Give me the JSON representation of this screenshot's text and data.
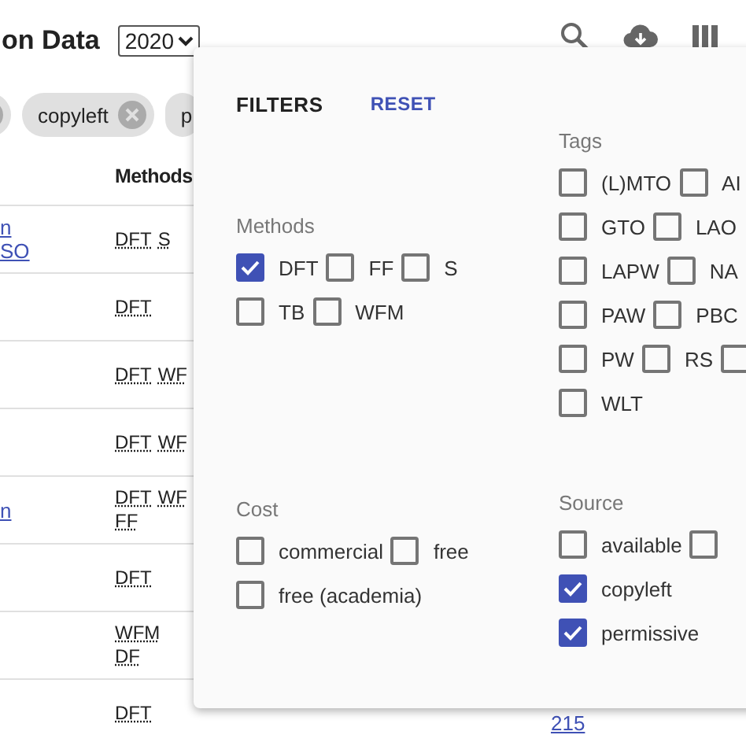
{
  "header": {
    "title": "on Data",
    "year": "2020"
  },
  "chips": [
    "copyleft",
    "p"
  ],
  "table": {
    "columns": [
      "Methods"
    ],
    "rows": [
      {
        "column_1": [
          "n",
          "SO"
        ],
        "methods": [
          "DFT",
          "S"
        ]
      },
      {
        "methods": [
          "DFT"
        ]
      },
      {
        "methods": [
          "DFT",
          "WF"
        ]
      },
      {
        "methods": [
          "DFT",
          "WF"
        ]
      },
      {
        "column_1": [
          "n"
        ],
        "methods": [
          "DFT",
          "WF",
          "FF"
        ]
      },
      {
        "methods": [
          "DFT"
        ]
      },
      {
        "methods": [
          "WFM",
          "DF"
        ]
      },
      {
        "methods": [
          "DFT"
        ],
        "column_4": "215"
      }
    ]
  },
  "filters": {
    "title": "FILTERS",
    "reset": "RESET",
    "columns": [
      {
        "groups": [
          {
            "label": "Methods",
            "rows": [
              [
                {
                  "label": "DFT",
                  "checked": true
                },
                {
                  "label": "FF",
                  "checked": false
                },
                {
                  "label": "S",
                  "checked": false
                }
              ],
              [
                {
                  "label": "TB",
                  "checked": false
                },
                {
                  "label": "WFM",
                  "checked": false
                }
              ]
            ]
          },
          {
            "label": "Cost",
            "rows": [
              [
                {
                  "label": "commercial",
                  "checked": false
                },
                {
                  "label": "free",
                  "checked": false
                }
              ],
              [
                {
                  "label": "free (academia)",
                  "checked": false
                }
              ]
            ]
          }
        ]
      },
      {
        "groups": [
          {
            "label": "Tags",
            "rows": [
              [
                {
                  "label": "(L)MTO",
                  "checked": false
                },
                {
                  "label": "AI",
                  "checked": false
                }
              ],
              [
                {
                  "label": "GTO",
                  "checked": false
                },
                {
                  "label": "LAO",
                  "checked": false
                }
              ],
              [
                {
                  "label": "LAPW",
                  "checked": false
                },
                {
                  "label": "NA",
                  "checked": false
                }
              ],
              [
                {
                  "label": "PAW",
                  "checked": false
                },
                {
                  "label": "PBC",
                  "checked": false
                }
              ],
              [
                {
                  "label": "PW",
                  "checked": false
                },
                {
                  "label": "RS",
                  "checked": false
                },
                {
                  "checked": false
                }
              ],
              [
                {
                  "label": "WLT",
                  "checked": false
                }
              ]
            ]
          },
          {
            "label": "Source",
            "rows": [
              [
                {
                  "label": "available",
                  "checked": false
                },
                {
                  "checked": false
                }
              ],
              [
                {
                  "label": "copyleft",
                  "checked": true
                }
              ],
              [
                {
                  "label": "permissive",
                  "checked": true
                }
              ]
            ]
          }
        ]
      }
    ]
  }
}
